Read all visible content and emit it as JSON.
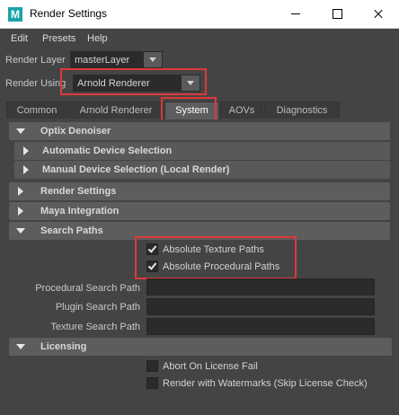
{
  "window": {
    "icon_letter": "M",
    "title": "Render Settings"
  },
  "menu": [
    "Edit",
    "Presets",
    "Help"
  ],
  "render_layer": {
    "label": "Render Layer",
    "value": "masterLayer"
  },
  "render_using": {
    "label": "Render Using",
    "value": "Arnold Renderer"
  },
  "tabs": [
    {
      "label": "Common",
      "active": false
    },
    {
      "label": "Arnold Renderer",
      "active": false
    },
    {
      "label": "System",
      "active": true
    },
    {
      "label": "AOVs",
      "active": false
    },
    {
      "label": "Diagnostics",
      "active": false
    }
  ],
  "sections": {
    "optix": "Optix Denoiser",
    "auto_device": "Automatic Device Selection",
    "manual_device": "Manual Device Selection (Local Render)",
    "render_settings": "Render Settings",
    "maya_integration": "Maya Integration",
    "search_paths": "Search Paths",
    "licensing": "Licensing"
  },
  "search_paths": {
    "abs_texture": {
      "label": "Absolute Texture Paths",
      "checked": true
    },
    "abs_procedural": {
      "label": "Absolute Procedural Paths",
      "checked": true
    },
    "procedural_label": "Procedural Search Path",
    "procedural_value": "",
    "plugin_label": "Plugin Search Path",
    "plugin_value": "",
    "texture_label": "Texture Search Path",
    "texture_value": ""
  },
  "licensing": {
    "abort": {
      "label": "Abort On License Fail",
      "checked": false
    },
    "watermarks": {
      "label": "Render with Watermarks (Skip License Check)",
      "checked": false
    }
  },
  "colors": {
    "highlight": "#e0383a",
    "background": "#444444",
    "frame": "#5d5d5d",
    "field": "#2b2b2b"
  }
}
